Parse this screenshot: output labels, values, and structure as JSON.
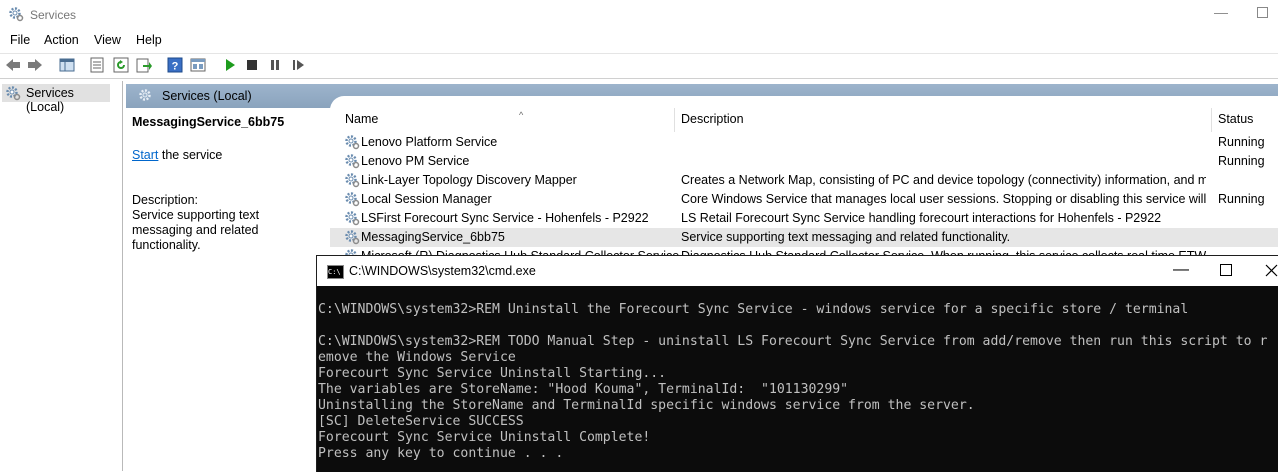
{
  "window": {
    "title": "Services"
  },
  "menu": [
    "File",
    "Action",
    "View",
    "Help"
  ],
  "tree": {
    "item": "Services (Local)"
  },
  "content_header": "Services (Local)",
  "detail": {
    "service_name": "MessagingService_6bb75",
    "start_link": "Start",
    "start_suffix": " the service",
    "description_label": "Description:",
    "description": "Service supporting text messaging and related functionality."
  },
  "columns": {
    "name": "Name",
    "description": "Description",
    "status": "Status"
  },
  "services": [
    {
      "name": "Lenovo Platform Service",
      "description": "",
      "status": "Running"
    },
    {
      "name": "Lenovo PM Service",
      "description": "",
      "status": "Running"
    },
    {
      "name": "Link-Layer Topology Discovery Mapper",
      "description": "Creates a Network Map, consisting of PC and device topology (connectivity) information, and me...",
      "status": ""
    },
    {
      "name": "Local Session Manager",
      "description": "Core Windows Service that manages local user sessions. Stopping or disabling this service will res...",
      "status": "Running"
    },
    {
      "name": "LSFirst Forecourt Sync Service - Hohenfels - P2922",
      "description": "LS Retail Forecourt Sync Service handling forecourt interactions for Hohenfels - P2922",
      "status": ""
    },
    {
      "name": "MessagingService_6bb75",
      "description": "Service supporting text messaging and related functionality.",
      "status": ""
    },
    {
      "name": "Microsoft (R) Diagnostics Hub Standard Collector Service",
      "description": "Diagnostics Hub Standard Collector Service. When running, this service collects real time ETW...",
      "status": ""
    }
  ],
  "cmd": {
    "title": "C:\\WINDOWS\\system32\\cmd.exe",
    "lines": [
      "",
      "C:\\WINDOWS\\system32>REM Uninstall the Forecourt Sync Service - windows service for a specific store / terminal",
      "",
      "C:\\WINDOWS\\system32>REM TODO Manual Step - uninstall LS Forecourt Sync Service from add/remove then run this script to r",
      "emove the Windows Service",
      "Forecourt Sync Service Uninstall Starting...",
      "The variables are StoreName: \"Hood Kouma\", TerminalId:  \"101130299\"",
      "Uninstalling the StoreName and TerminalId specific windows service from the server.",
      "[SC] DeleteService SUCCESS",
      "Forecourt Sync Service Uninstall Complete!",
      "Press any key to continue . . ."
    ]
  },
  "icons": {
    "app": "gear-icon",
    "toolbar": [
      "back-icon",
      "forward-icon",
      "console-tree-icon",
      "properties-icon",
      "refresh-icon",
      "export-icon",
      "help-icon",
      "view-icon",
      "start-service-icon",
      "stop-service-icon",
      "pause-service-icon",
      "restart-service-icon"
    ]
  },
  "colors": {
    "header_blue": "#8aa3bd",
    "link": "#0066cc",
    "cmd_bg": "#0c0c0c",
    "cmd_text": "#c0c0c0"
  }
}
